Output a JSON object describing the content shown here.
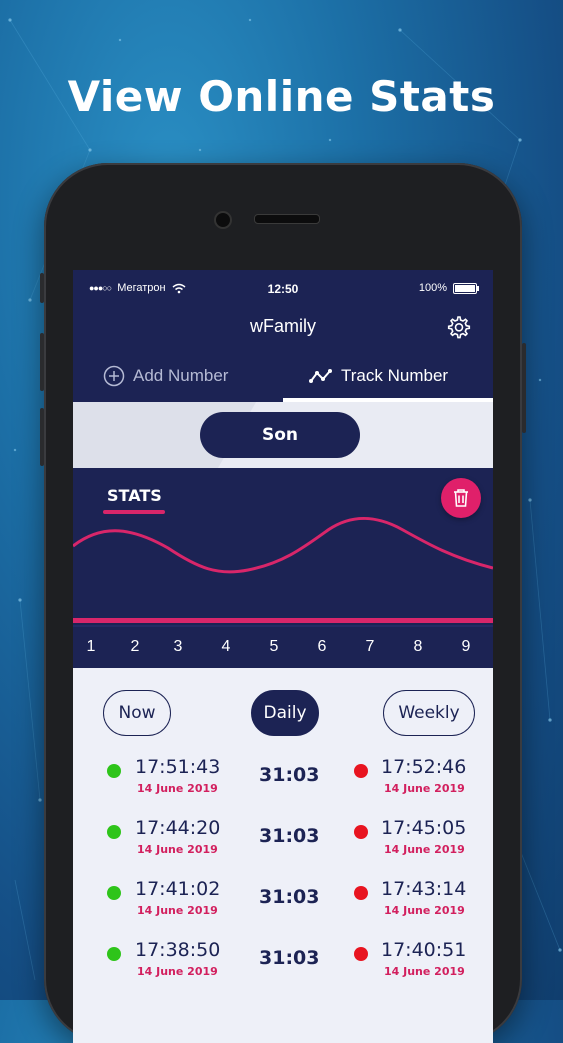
{
  "promo": {
    "headline": "View Online Stats"
  },
  "status_bar": {
    "signal": "●●●○○",
    "carrier": "Мегатрон",
    "time": "12:50",
    "battery": "100%"
  },
  "header": {
    "title": "wFamily",
    "settings_icon": "gear-icon"
  },
  "tabs": [
    {
      "label": "Add Number",
      "icon": "plus-circle-icon",
      "active": false
    },
    {
      "label": "Track Number",
      "icon": "trend-line-icon",
      "active": true
    }
  ],
  "contact": {
    "name": "Son"
  },
  "stats": {
    "title": "STATS",
    "delete_icon": "trash-icon",
    "axis_labels": [
      "1",
      "2",
      "3",
      "4",
      "5",
      "6",
      "7",
      "8",
      "9"
    ]
  },
  "filters": [
    {
      "label": "Now",
      "active": false
    },
    {
      "label": "Daily",
      "active": true
    },
    {
      "label": "Weekly",
      "active": false
    }
  ],
  "sessions": [
    {
      "start_time": "17:51:43",
      "start_date": "14 June 2019",
      "duration": "31:03",
      "end_time": "17:52:46",
      "end_date": "14 June 2019"
    },
    {
      "start_time": "17:44:20",
      "start_date": "14 June 2019",
      "duration": "31:03",
      "end_time": "17:45:05",
      "end_date": "14 June 2019"
    },
    {
      "start_time": "17:41:02",
      "start_date": "14 June 2019",
      "duration": "31:03",
      "end_time": "17:43:14",
      "end_date": "14 June 2019"
    },
    {
      "start_time": "17:38:50",
      "start_date": "14 June 2019",
      "duration": "31:03",
      "end_time": "17:40:51",
      "end_date": "14 June 2019"
    }
  ],
  "colors": {
    "navy": "#1c2354",
    "accent_pink": "#d8266a",
    "online_green": "#2ec41a",
    "offline_red": "#e81420"
  }
}
